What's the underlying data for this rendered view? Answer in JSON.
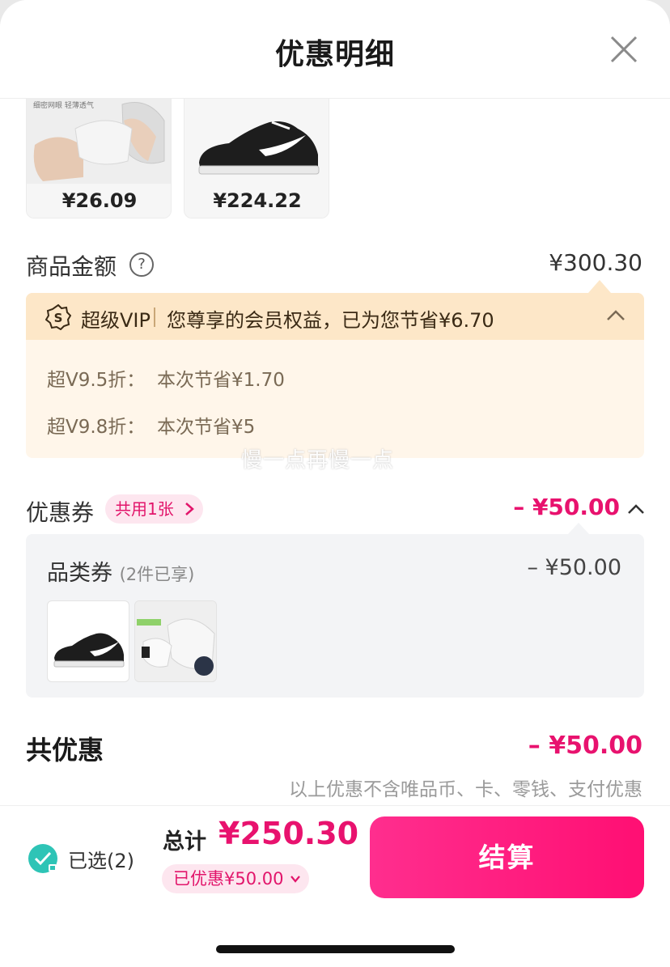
{
  "header": {
    "title": "优惠明细",
    "close_icon": "close-icon"
  },
  "products": [
    {
      "price": "¥26.09",
      "image": "socks-product-image"
    },
    {
      "price": "¥224.22",
      "image": "sneaker-product-image"
    }
  ],
  "goods": {
    "label": "商品金额",
    "help_icon": "?",
    "amount": "¥300.30"
  },
  "vip": {
    "brand": "超级VIP",
    "summary": "您尊享的会员权益，已为您节省¥6.70",
    "lines": [
      {
        "key": "超V9.5折：",
        "value": "本次节省¥1.70"
      },
      {
        "key": "超V9.8折：",
        "value": "本次节省¥5"
      }
    ]
  },
  "watermark": "慢一点再慢一点",
  "coupon": {
    "label": "优惠券",
    "chip": "共用1张",
    "amount": "– ¥50.00",
    "category": {
      "label": "品类券",
      "sub": "(2件已享)",
      "amount": "– ¥50.00"
    }
  },
  "total_discount": {
    "label": "共优惠",
    "amount": "– ¥50.00",
    "note": "以上优惠不含唯品币、卡、零钱、支付优惠"
  },
  "footer": {
    "selected": "已选(2)",
    "sum_label": "总计",
    "sum_value": "¥250.30",
    "saved": "已优惠¥50.00",
    "checkout": "结算"
  },
  "colors": {
    "accent": "#e8126e",
    "vip_bg": "#fff6ea",
    "vip_head": "#fde7c8",
    "check": "#2ec4b6"
  }
}
